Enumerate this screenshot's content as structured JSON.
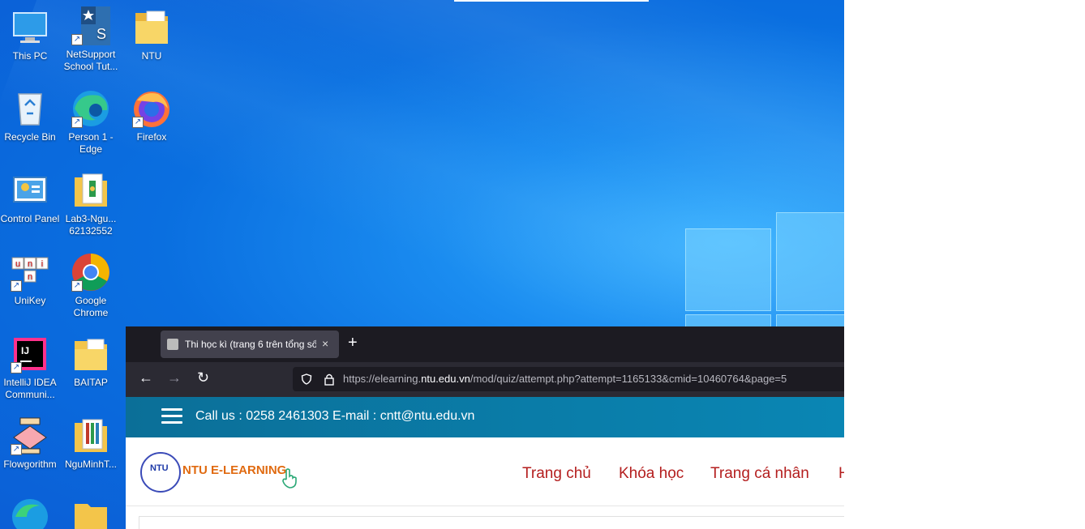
{
  "desktop": {
    "icons": [
      {
        "id": "this-pc",
        "label": "This PC"
      },
      {
        "id": "netsupport",
        "label": "NetSupport School Tut..."
      },
      {
        "id": "ntu",
        "label": "NTU"
      },
      {
        "id": "recycle-bin",
        "label": "Recycle Bin"
      },
      {
        "id": "edge-person1",
        "label": "Person 1 - Edge"
      },
      {
        "id": "firefox",
        "label": "Firefox"
      },
      {
        "id": "control-panel",
        "label": "Control Panel"
      },
      {
        "id": "lab3",
        "label": "Lab3-Ngu... 62132552"
      },
      {
        "id": "unikey",
        "label": "UniKey"
      },
      {
        "id": "chrome",
        "label": "Google Chrome"
      },
      {
        "id": "intellij",
        "label": "IntelliJ IDEA Communi..."
      },
      {
        "id": "baitap",
        "label": "BAITAP"
      },
      {
        "id": "flowgorithm",
        "label": "Flowgorithm"
      },
      {
        "id": "nguminh",
        "label": "NguMinhT..."
      }
    ]
  },
  "browser": {
    "tab_title": "Thi học kì (trang 6 trên tổng số",
    "tab_close": "×",
    "new_tab": "+",
    "back": "←",
    "forward": "→",
    "reload": "↻",
    "url_prefix": "https://elearning.",
    "url_domain": "ntu.edu.vn",
    "url_path": "/mod/quiz/attempt.php?attempt=1165133&cmid=10460764&page=5"
  },
  "site": {
    "contact": "Call us : 0258 2461303  E-mail : cntt@ntu.edu.vn",
    "logo_text": "NTU E-LEARNING",
    "logo_mark": "NTU",
    "menu": [
      "Trang chủ",
      "Khóa học",
      "Trang cá nhân",
      "H"
    ]
  },
  "colors": {
    "infobar": "#0a7ea8",
    "menu_text": "#b41e1e",
    "logo_text": "#e06a10"
  }
}
